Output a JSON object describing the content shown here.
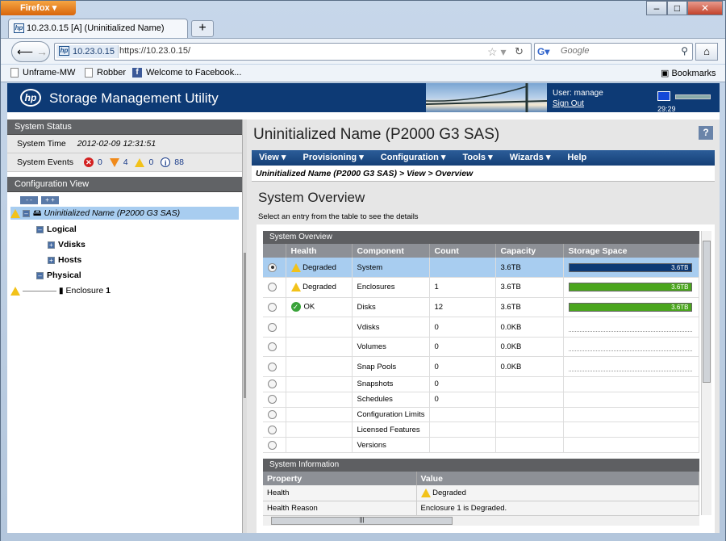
{
  "browser": {
    "menu_button": "Firefox",
    "tab_title": "10.23.0.15 [A] (Uninitialized Name)",
    "url_identity": "10.23.0.15",
    "url": "https://10.23.0.15/",
    "search_placeholder": "Google",
    "bookmarks": [
      "Unframe-MW",
      "Robber",
      "Welcome to Facebook..."
    ],
    "bookmarks_menu": "Bookmarks"
  },
  "app": {
    "title": "Storage Management Utility",
    "user_label": "User: manage",
    "sign_out": "Sign Out",
    "clock": "29:29"
  },
  "status": {
    "header": "System Status",
    "time_label": "System Time",
    "time_value": "2012-02-09 12:31:51",
    "events_label": "System Events",
    "events": {
      "critical": "0",
      "error": "4",
      "warning": "0",
      "info": "88"
    }
  },
  "config": {
    "header": "Configuration View",
    "collapse": "- -",
    "expand": "+ +",
    "root": "Uninitialized Name (P2000 G3 SAS)",
    "logical": "Logical",
    "vdisks": "Vdisks",
    "hosts": "Hosts",
    "physical": "Physical",
    "enclosure_prefix": "Enclosure",
    "enclosure_num": "1"
  },
  "main": {
    "title": "Uninitialized Name (P2000 G3 SAS)",
    "help": "?",
    "menu": [
      "View ▾",
      "Provisioning ▾",
      "Configuration ▾",
      "Tools ▾",
      "Wizards ▾",
      "Help"
    ],
    "breadcrumb": "Uninitialized Name (P2000 G3 SAS) > View > Overview",
    "overview_title": "System Overview",
    "overview_sub": "Select an entry from the table to see the details"
  },
  "overview_table": {
    "caption": "System Overview",
    "columns": [
      "Health",
      "Component",
      "Count",
      "Capacity",
      "Storage Space"
    ],
    "rows": [
      {
        "selected": true,
        "health": "Degraded",
        "health_icon": "warning",
        "component": "System",
        "count": "",
        "capacity": "3.6TB",
        "bar_label": "3.6TB",
        "bar_color": "#0d3a75",
        "bar_fill": 1.0
      },
      {
        "selected": false,
        "health": "Degraded",
        "health_icon": "warning",
        "component": "Enclosures",
        "count": "1",
        "capacity": "3.6TB",
        "bar_label": "3.6TB",
        "bar_color": "#4aa51d",
        "bar_fill": 1.0
      },
      {
        "selected": false,
        "health": "OK",
        "health_icon": "ok",
        "component": "Disks",
        "count": "12",
        "capacity": "3.6TB",
        "bar_label": "3.6TB",
        "bar_color": "#4aa51d",
        "bar_fill": 1.0
      },
      {
        "selected": false,
        "health": "",
        "component": "Vdisks",
        "count": "0",
        "capacity": "0.0KB"
      },
      {
        "selected": false,
        "health": "",
        "component": "Volumes",
        "count": "0",
        "capacity": "0.0KB"
      },
      {
        "selected": false,
        "health": "",
        "component": "Snap Pools",
        "count": "0",
        "capacity": "0.0KB"
      },
      {
        "selected": false,
        "health": "",
        "component": "Snapshots",
        "count": "0",
        "capacity": ""
      },
      {
        "selected": false,
        "health": "",
        "component": "Schedules",
        "count": "0",
        "capacity": ""
      },
      {
        "selected": false,
        "health": "",
        "component": "Configuration Limits",
        "count": "",
        "capacity": ""
      },
      {
        "selected": false,
        "health": "",
        "component": "Licensed Features",
        "count": "",
        "capacity": ""
      },
      {
        "selected": false,
        "health": "",
        "component": "Versions",
        "count": "",
        "capacity": ""
      }
    ]
  },
  "system_info": {
    "caption": "System Information",
    "columns": [
      "Property",
      "Value"
    ],
    "rows": [
      {
        "property": "Health",
        "value": "Degraded"
      },
      {
        "property": "Health Reason",
        "value": "Enclosure 1 is Degraded."
      }
    ]
  }
}
